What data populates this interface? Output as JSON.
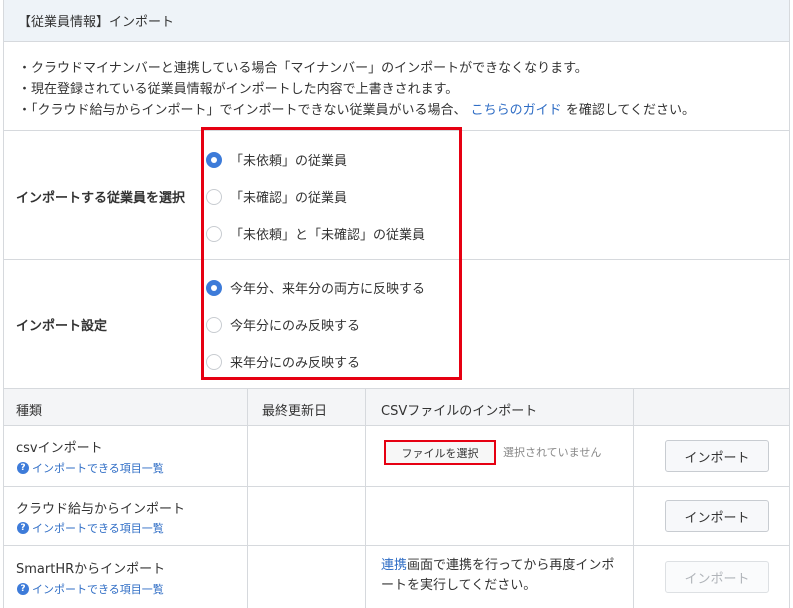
{
  "header": {
    "title": "【従業員情報】インポート"
  },
  "notes": {
    "line1": "・クラウドマイナンバーと連携している場合「マイナンバー」のインポートができなくなります。",
    "line2": "・現在登録されている従業員情報がインポートした内容で上書きされます。",
    "line3_before": "・「クラウド給与からインポート」でインポートできない従業員がいる場合、",
    "line3_link": "こちらのガイド",
    "line3_after": " を確認してください。"
  },
  "employee_select": {
    "label": "インポートする従業員を選択",
    "options": [
      {
        "label": "「未依頼」の従業員",
        "checked": true
      },
      {
        "label": "「未確認」の従業員",
        "checked": false
      },
      {
        "label": "「未依頼」と「未確認」の従業員",
        "checked": false
      }
    ]
  },
  "import_settings": {
    "label": "インポート設定",
    "options": [
      {
        "label": "今年分、来年分の両方に反映する",
        "checked": true
      },
      {
        "label": "今年分にのみ反映する",
        "checked": false
      },
      {
        "label": "来年分にのみ反映する",
        "checked": false
      }
    ]
  },
  "table": {
    "headers": [
      "種類",
      "最終更新日",
      "CSVファイルのインポート",
      ""
    ],
    "rows": [
      {
        "title": "csvインポート",
        "link": "インポートできる項目一覧",
        "last_updated": "",
        "file_button": "ファイルを選択",
        "file_status": "選択されていません",
        "import_label": "インポート",
        "enabled": true
      },
      {
        "title": "クラウド給与からインポート",
        "link": "インポートできる項目一覧",
        "last_updated": "",
        "import_label": "インポート",
        "enabled": true
      },
      {
        "title": "SmartHRからインポート",
        "link": "インポートできる項目一覧",
        "last_updated": "",
        "note_link": "連携",
        "note_text": "画面で連携を行ってから再度インポートを実行してください。",
        "import_label": "インポート",
        "enabled": false
      }
    ]
  },
  "colors": {
    "accent": "#3d7bd9",
    "link": "#2f6dc5",
    "highlight": "#e60012",
    "header_bg": "#eef3f8"
  }
}
